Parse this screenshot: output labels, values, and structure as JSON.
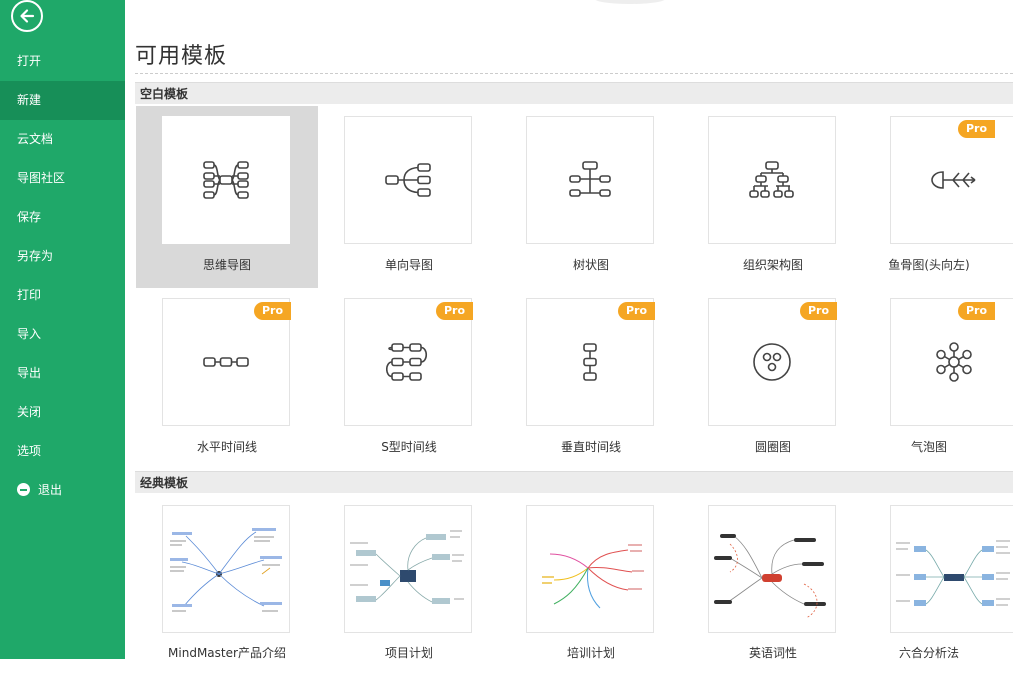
{
  "sidebar": {
    "items": [
      {
        "label": "打开"
      },
      {
        "label": "新建"
      },
      {
        "label": "云文档"
      },
      {
        "label": "导图社区"
      },
      {
        "label": "保存"
      },
      {
        "label": "另存为"
      },
      {
        "label": "打印"
      },
      {
        "label": "导入"
      },
      {
        "label": "导出"
      },
      {
        "label": "关闭"
      },
      {
        "label": "选项"
      },
      {
        "label": "退出"
      }
    ],
    "active_index": 1,
    "colors": {
      "background": "#1fa869",
      "active": "#178f58"
    },
    "icons": {
      "back": "arrow-left-circle-icon",
      "exit": "minus-circle-icon"
    }
  },
  "main": {
    "title": "可用模板",
    "blank_section": {
      "heading": "空白模板",
      "templates": [
        {
          "label": "思维导图",
          "icon": "mind-map-icon",
          "pro": false,
          "selected": true
        },
        {
          "label": "单向导图",
          "icon": "right-map-icon",
          "pro": false
        },
        {
          "label": "树状图",
          "icon": "tree-map-icon",
          "pro": false
        },
        {
          "label": "组织架构图",
          "icon": "org-chart-icon",
          "pro": false
        },
        {
          "label": "鱼骨图(头向左)",
          "icon": "fishbone-icon",
          "pro": true
        },
        {
          "label": "水平时间线",
          "icon": "horizontal-timeline-icon",
          "pro": true
        },
        {
          "label": "S型时间线",
          "icon": "s-timeline-icon",
          "pro": true
        },
        {
          "label": "垂直时间线",
          "icon": "vertical-timeline-icon",
          "pro": true
        },
        {
          "label": "圆圈图",
          "icon": "circle-map-icon",
          "pro": true
        },
        {
          "label": "气泡图",
          "icon": "bubble-map-icon",
          "pro": true
        }
      ],
      "pro_badge": "Pro"
    },
    "classic_section": {
      "heading": "经典模板",
      "templates": [
        {
          "label": "MindMaster产品介绍"
        },
        {
          "label": "项目计划"
        },
        {
          "label": "培训计划"
        },
        {
          "label": "英语词性"
        },
        {
          "label": "六合分析法"
        }
      ]
    },
    "colors": {
      "pro_badge": "#f5a623",
      "section_bg": "#ececec",
      "selected_bg": "#d9d9d9"
    }
  }
}
